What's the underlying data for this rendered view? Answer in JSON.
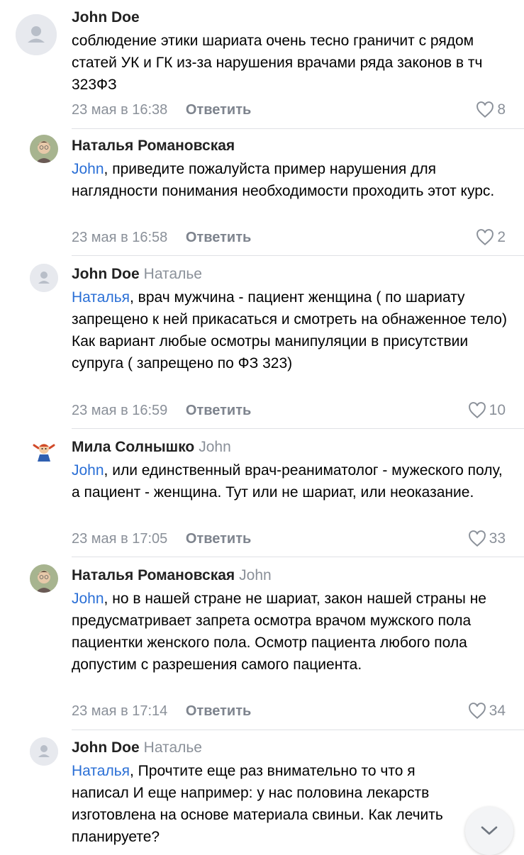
{
  "comments": [
    {
      "author": "John Doe",
      "reply_to": "",
      "mention": "",
      "text": "соблюдение этики шариата очень тесно граничит с рядом статей УК и ГК из-за нарушения врачами ряда законов в тч 323ФЗ",
      "time": "23 мая в 16:38",
      "reply_label": "Ответить",
      "likes": "8",
      "avatar": "default-user-icon"
    },
    {
      "author": "Наталья Романовская",
      "reply_to": "",
      "mention": "John",
      "text": ", приведите пожалуйста пример нарушения для наглядности понимания необходимости проходить этот курс.",
      "time": "23 мая в 16:58",
      "reply_label": "Ответить",
      "likes": "2",
      "avatar": "user-photo"
    },
    {
      "author": "John Doe",
      "reply_to": "Наталье",
      "mention": "Наталья",
      "text": ", врач мужчина - пациент женщина ( по шариату запрещено к ней прикасаться и смотреть на обнаженное тело) Как вариант любые осмотры манипуляции в присутствии супруга ( запрещено по ФЗ 323)",
      "time": "23 мая в 16:59",
      "reply_label": "Ответить",
      "likes": "10",
      "avatar": "default-user-icon"
    },
    {
      "author": "Мила Солнышко",
      "reply_to": "John",
      "mention": "John",
      "text": ", или единственный врач-реаниматолог - мужеского полу, а пациент - женщина. Тут или не шариат, или неоказание.",
      "time": "23 мая в 17:05",
      "reply_label": "Ответить",
      "likes": "33",
      "avatar": "cartoon-girl"
    },
    {
      "author": "Наталья Романовская",
      "reply_to": "John",
      "mention": "John",
      "text": ", но в нашей стране не шариат, закон нашей страны не предусматривает запрета осмотра врачом мужского пола пациентки женского пола. Осмотр пациента любого пола допустим с разрешения самого пациента.",
      "time": "23 мая в 17:14",
      "reply_label": "Ответить",
      "likes": "34",
      "avatar": "user-photo"
    },
    {
      "author": "John Doe",
      "reply_to": "Наталье",
      "mention": "Наталья",
      "text": ", Прочтите еще раз внимательно то что я написал И еще например: у нас половина лекарств изготовлена на основе материала свиньи. Как лечить планируете?",
      "time": "",
      "reply_label": "",
      "likes": "",
      "avatar": "default-user-icon"
    }
  ],
  "colors": {
    "link": "#2a6fd6",
    "secondary": "#8a9099",
    "divider": "#dfe1e5"
  }
}
